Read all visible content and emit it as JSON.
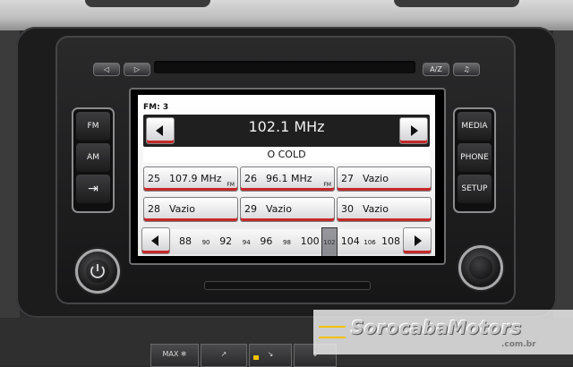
{
  "colors": {
    "accent": "#c62828",
    "watermark_yellow": "#f2c200"
  },
  "top_buttons": [
    {
      "label": "◁",
      "icon": "seek-back-icon"
    },
    {
      "label": "▷",
      "icon": "seek-forward-icon"
    },
    {
      "label": "A/Z",
      "icon": ""
    },
    {
      "label": "♫",
      "icon": "music-note-icon"
    }
  ],
  "left_buttons": [
    {
      "label": "FM"
    },
    {
      "label": "AM"
    },
    {
      "label": "⇥",
      "icon": "source-icon"
    }
  ],
  "right_buttons": [
    {
      "label": "MEDIA"
    },
    {
      "label": "PHONE"
    },
    {
      "label": "SETUP"
    }
  ],
  "screen": {
    "band_label": "FM: 3",
    "frequency": "102.1 MHz",
    "rds_text": "O COLD",
    "presets": [
      {
        "number": "25",
        "value": "107.9 MHz",
        "tag": "FM"
      },
      {
        "number": "26",
        "value": "96.1 MHz",
        "tag": "FM"
      },
      {
        "number": "27",
        "value": "Vazio",
        "tag": ""
      },
      {
        "number": "28",
        "value": "Vazio",
        "tag": ""
      },
      {
        "number": "29",
        "value": "Vazio",
        "tag": ""
      },
      {
        "number": "30",
        "value": "Vazio",
        "tag": ""
      }
    ],
    "tuner_scale": [
      "88",
      "90",
      "92",
      "94",
      "96",
      "98",
      "100",
      "102",
      "104",
      "106",
      "108"
    ],
    "tuner_position_mhz": 102.1
  },
  "hvac_buttons": [
    {
      "label": "MAX ❄",
      "icon": "max-defrost-icon"
    },
    {
      "label": "",
      "icon": "airflow-face-icon"
    },
    {
      "label": "",
      "icon": "airflow-feet-icon"
    },
    {
      "label": "",
      "icon": "airflow-seat-icon"
    },
    {
      "label": "",
      "icon": "recirculation-icon"
    },
    {
      "label": "",
      "icon": "rear-defrost-icon"
    }
  ],
  "watermark": {
    "brand": "SorocabaMotors",
    "domain": ".com.br"
  }
}
